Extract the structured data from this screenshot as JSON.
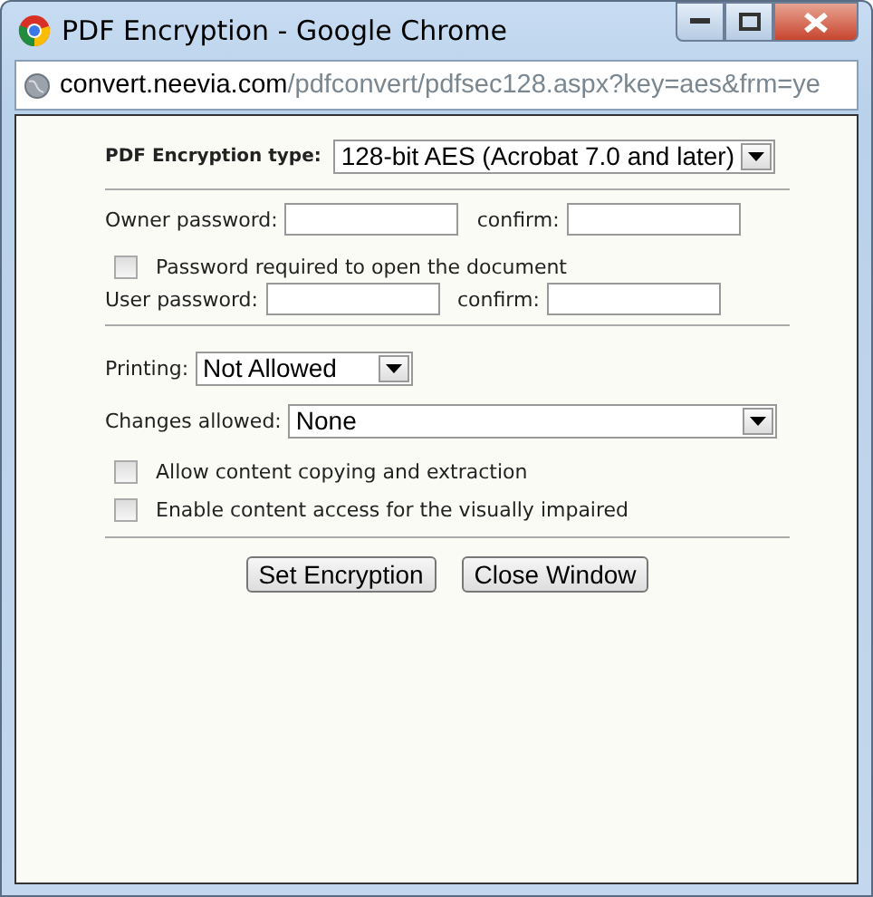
{
  "window": {
    "title": "PDF Encryption - Google Chrome"
  },
  "address_bar": {
    "host": "convert.neevia.com",
    "path": "/pdfconvert/pdfsec128.aspx?key=aes&frm=ye"
  },
  "form": {
    "encryption_type": {
      "label": "PDF Encryption type:",
      "value": "128-bit AES (Acrobat 7.0 and later)"
    },
    "owner_password": {
      "label": "Owner password:",
      "confirm_label": "confirm:"
    },
    "open_password_required": {
      "label": "Password required to open the document",
      "checked": false
    },
    "user_password": {
      "label": "User password:",
      "confirm_label": "confirm:"
    },
    "printing": {
      "label": "Printing:",
      "value": "Not Allowed"
    },
    "changes_allowed": {
      "label": "Changes allowed:",
      "value": "None"
    },
    "options": [
      {
        "label": "Allow content copying and extraction",
        "checked": false
      },
      {
        "label": "Enable content access for the visually impaired",
        "checked": false
      }
    ],
    "buttons": [
      "Set Encryption",
      "Close Window"
    ]
  }
}
